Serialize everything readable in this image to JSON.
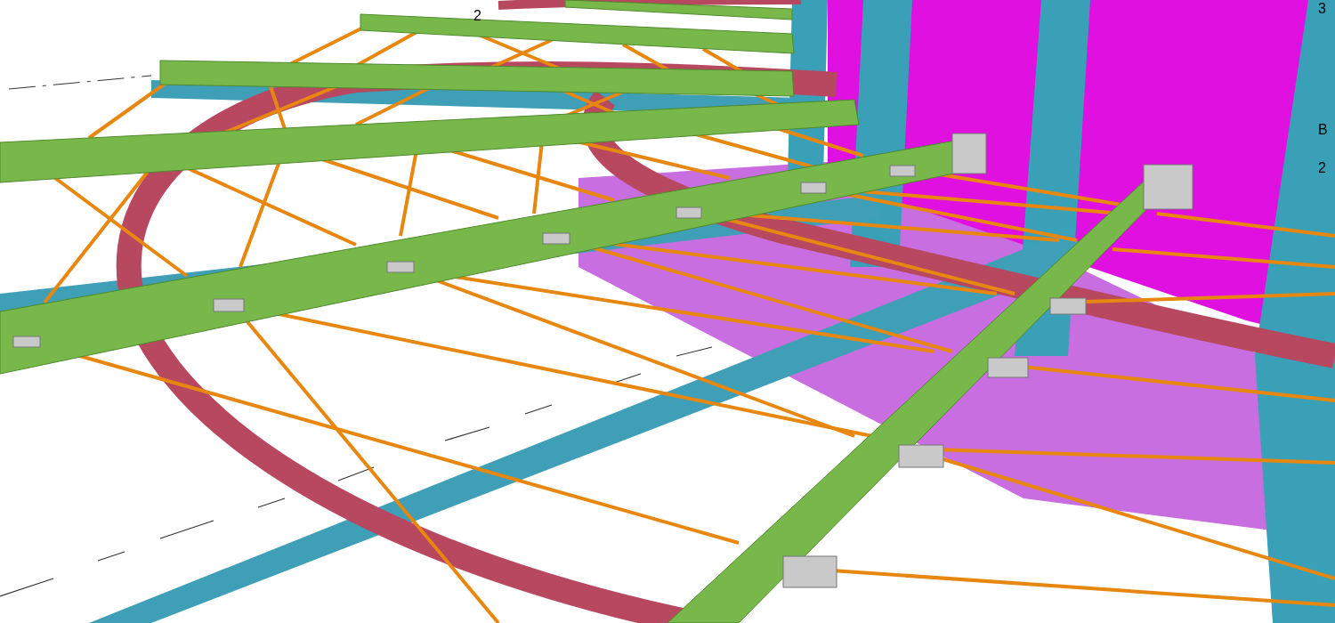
{
  "viewport": {
    "grid_labels": [
      {
        "text": "2"
      },
      {
        "text": "3"
      },
      {
        "text": "B"
      },
      {
        "text": "2"
      }
    ]
  }
}
